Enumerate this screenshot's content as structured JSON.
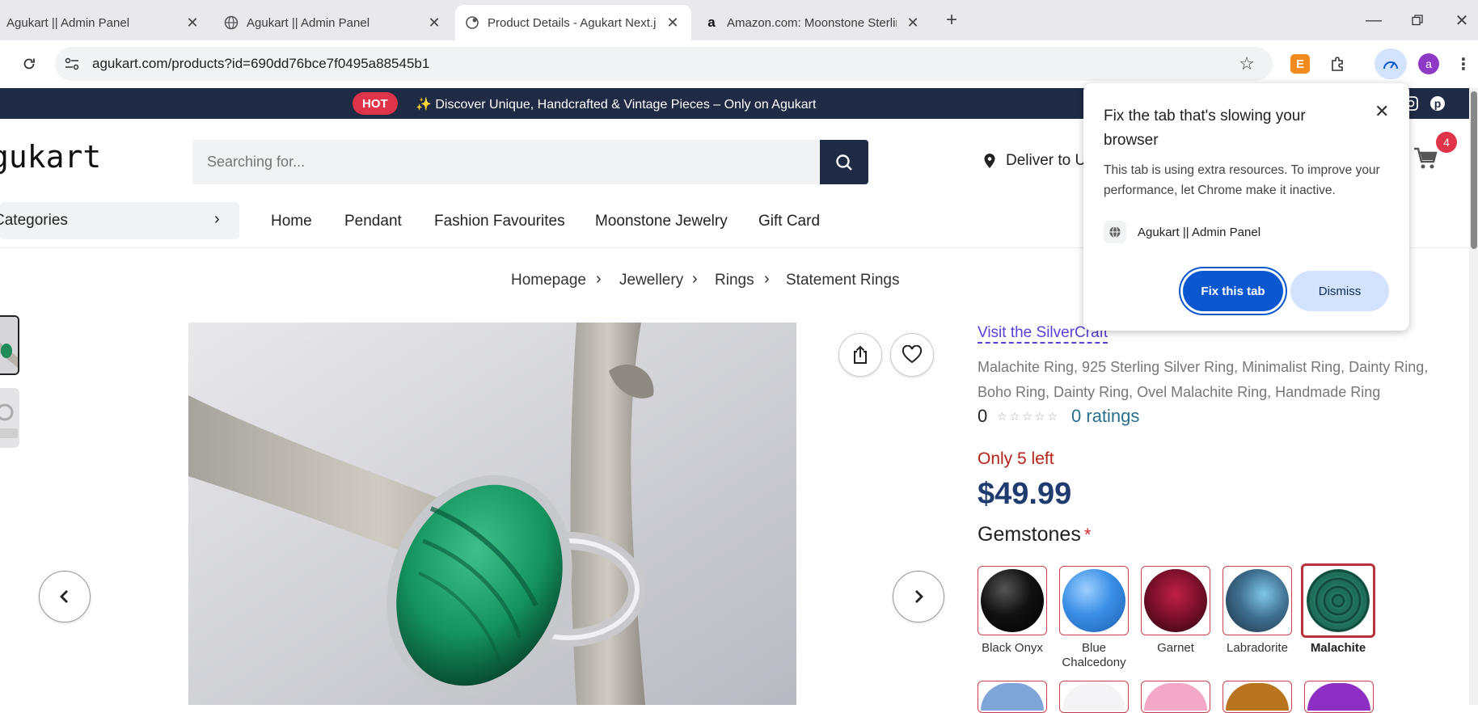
{
  "browser": {
    "tabs": [
      {
        "title": "Agukart || Admin Panel",
        "favicon": "none",
        "active": false
      },
      {
        "title": "Agukart || Admin Panel",
        "favicon": "globe-icon",
        "active": false
      },
      {
        "title": "Product Details - Agukart Next.js",
        "favicon": "site-icon",
        "active": true
      },
      {
        "title": "Amazon.com: Moonstone Sterling",
        "favicon": "amazon-icon",
        "active": false
      }
    ],
    "url": "agukart.com/products?id=690dd76bce7f0495a88545b1",
    "profile_initial": "a",
    "extension_badge": "E"
  },
  "promo": {
    "badge": "HOT",
    "text": "✨ Discover Unique, Handcrafted & Vintage Pieces – Only on Agukart"
  },
  "header": {
    "logo": "gukart",
    "search_placeholder": "Searching for...",
    "deliver": "Deliver to U",
    "cart_count": "4"
  },
  "nav": {
    "categories_label": "Categories",
    "items": [
      "Home",
      "Pendant",
      "Fashion Favourites",
      "Moonstone Jewelry",
      "Gift Card"
    ]
  },
  "breadcrumb": [
    "Homepage",
    "Jewellery",
    "Rings",
    "Statement Rings"
  ],
  "product": {
    "store_link": "Visit the SilverCraft",
    "title": "Malachite Ring, 925 Sterling Silver Ring, Minimalist Ring, Dainty Ring, Boho Ring, Dainty Ring, Ovel Malachite Ring, Handmade Ring",
    "rating": "0",
    "stars": "☆☆☆☆☆",
    "rating_count": "0 ratings",
    "stock": "Only 5 left",
    "price": "$49.99",
    "gemstones_label": "Gemstones",
    "required_mark": "*",
    "gemstones": [
      {
        "name": "Black Onyx",
        "color": "#111111",
        "selected": false
      },
      {
        "name": "Blue Chalcedony",
        "color": "#3a8fe6",
        "selected": false
      },
      {
        "name": "Garnet",
        "color": "#7a0f2a",
        "selected": false
      },
      {
        "name": "Labradorite",
        "color": "#3f6f8f",
        "selected": false
      },
      {
        "name": "Malachite",
        "color": "#1f6e5a",
        "selected": true
      }
    ]
  },
  "popup": {
    "title": "Fix the tab that's slowing your browser",
    "body": "This tab is using extra resources. To improve your performance, let Chrome make it inactive.",
    "tab_name": "Agukart || Admin Panel",
    "fix_label": "Fix this tab",
    "dismiss_label": "Dismiss"
  },
  "colors": {
    "brand_dark": "#1f2a44",
    "accent_red": "#e0344a",
    "price_blue": "#1f3b70",
    "chrome_blue": "#0b57d0"
  }
}
